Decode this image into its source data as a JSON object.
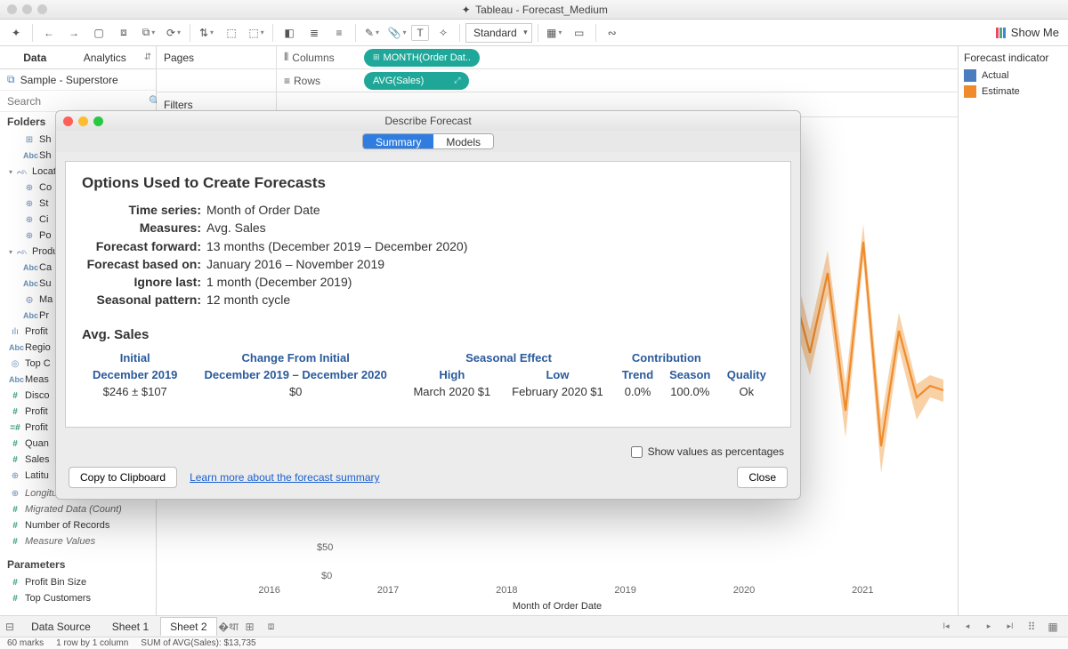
{
  "window": {
    "title": "Tableau - Forecast_Medium"
  },
  "toolbar": {
    "fit": "Standard",
    "showme": "Show Me"
  },
  "sidebar": {
    "tabs": [
      "Data",
      "Analytics"
    ],
    "datasource": "Sample - Superstore",
    "search_placeholder": "Search",
    "section_folders": "Folders",
    "fields": [
      {
        "icon": "date",
        "label": "Sh",
        "indent": 1
      },
      {
        "icon": "abc",
        "label": "Sh",
        "indent": 1
      },
      {
        "icon": "hier",
        "label": "Locat",
        "indent": 0,
        "caret": true
      },
      {
        "icon": "globe",
        "label": "Co",
        "indent": 1
      },
      {
        "icon": "globe",
        "label": "St",
        "indent": 1
      },
      {
        "icon": "globe",
        "label": "Ci",
        "indent": 1
      },
      {
        "icon": "globe",
        "label": "Po",
        "indent": 1
      },
      {
        "icon": "hier",
        "label": "Produ",
        "indent": 0,
        "caret": true
      },
      {
        "icon": "abc",
        "label": "Ca",
        "indent": 1
      },
      {
        "icon": "abc",
        "label": "Su",
        "indent": 1
      },
      {
        "icon": "clip",
        "label": "Ma",
        "indent": 1
      },
      {
        "icon": "abc",
        "label": "Pr",
        "indent": 1
      },
      {
        "icon": "bar",
        "label": "Profit",
        "indent": 0
      },
      {
        "icon": "abc",
        "label": "Regio",
        "indent": 0
      },
      {
        "icon": "set",
        "label": "Top C",
        "indent": 0
      },
      {
        "icon": "abc",
        "label": "Meas",
        "indent": 0
      },
      {
        "icon": "hash",
        "label": "Disco",
        "indent": 0
      },
      {
        "icon": "hash",
        "label": "Profit",
        "indent": 0
      },
      {
        "icon": "calc",
        "label": "Profit",
        "indent": 0
      },
      {
        "icon": "hash",
        "label": "Quan",
        "indent": 0
      },
      {
        "icon": "hash",
        "label": "Sales",
        "indent": 0
      },
      {
        "icon": "globe",
        "label": "Latitu",
        "indent": 0
      }
    ],
    "extra_fields": [
      {
        "icon": "globe",
        "label": "Longitude (generated)",
        "italic": true
      },
      {
        "icon": "hash",
        "label": "Migrated Data (Count)",
        "italic": true
      },
      {
        "icon": "hash",
        "label": "Number of Records",
        "italic": false
      },
      {
        "icon": "hash",
        "label": "Measure Values",
        "italic": true
      }
    ],
    "section_params": "Parameters",
    "params": [
      {
        "icon": "hash",
        "label": "Profit Bin Size"
      },
      {
        "icon": "hash",
        "label": "Top Customers"
      }
    ]
  },
  "shelves": {
    "pages": "Pages",
    "columns": "Columns",
    "rows": "Rows",
    "filters": "Filters",
    "col_pill": "MONTH(Order Dat..",
    "row_pill": "AVG(Sales)"
  },
  "legend": {
    "title": "Forecast indicator",
    "items": [
      {
        "color": "#4a7dbf",
        "label": "Actual"
      },
      {
        "color": "#ef8b2c",
        "label": "Estimate"
      }
    ]
  },
  "axis": {
    "y": [
      "$50",
      "$0"
    ],
    "x": [
      "2016",
      "2017",
      "2018",
      "2019",
      "2020",
      "2021"
    ],
    "xlabel": "Month of Order Date"
  },
  "tabs": {
    "datasource": "Data Source",
    "sheets": [
      "Sheet 1",
      "Sheet 2"
    ]
  },
  "status": {
    "marks": "60 marks",
    "rc": "1 row by 1 column",
    "sum": "SUM of AVG(Sales): $13,735"
  },
  "modal": {
    "title": "Describe Forecast",
    "tabs": [
      "Summary",
      "Models"
    ],
    "heading": "Options Used to Create Forecasts",
    "rows": [
      {
        "k": "Time series:",
        "v": "Month of Order Date"
      },
      {
        "k": "Measures:",
        "v": "Avg. Sales"
      },
      {
        "k": "Forecast forward:",
        "v": "13 months (December 2019 – December 2020)"
      },
      {
        "k": "Forecast based on:",
        "v": "January 2016 – November 2019"
      },
      {
        "k": "Ignore last:",
        "v": "1 month (December 2019)"
      },
      {
        "k": "Seasonal pattern:",
        "v": "12 month cycle"
      }
    ],
    "measure_heading": "Avg. Sales",
    "table": {
      "group_headers": [
        "Initial",
        "Change From Initial",
        "Seasonal Effect",
        "Contribution",
        ""
      ],
      "sub_headers": [
        "December 2019",
        "December 2019 – December 2020",
        "High",
        "Low",
        "Trend",
        "Season",
        "Quality"
      ],
      "row": [
        "$246   ±   $107",
        "$0",
        "March 2020  $1",
        "February 2020  $1",
        "0.0%",
        "100.0%",
        "Ok"
      ]
    },
    "percent_label": "Show values as percentages",
    "copy": "Copy to Clipboard",
    "learn": "Learn more about the forecast summary",
    "close": "Close"
  }
}
